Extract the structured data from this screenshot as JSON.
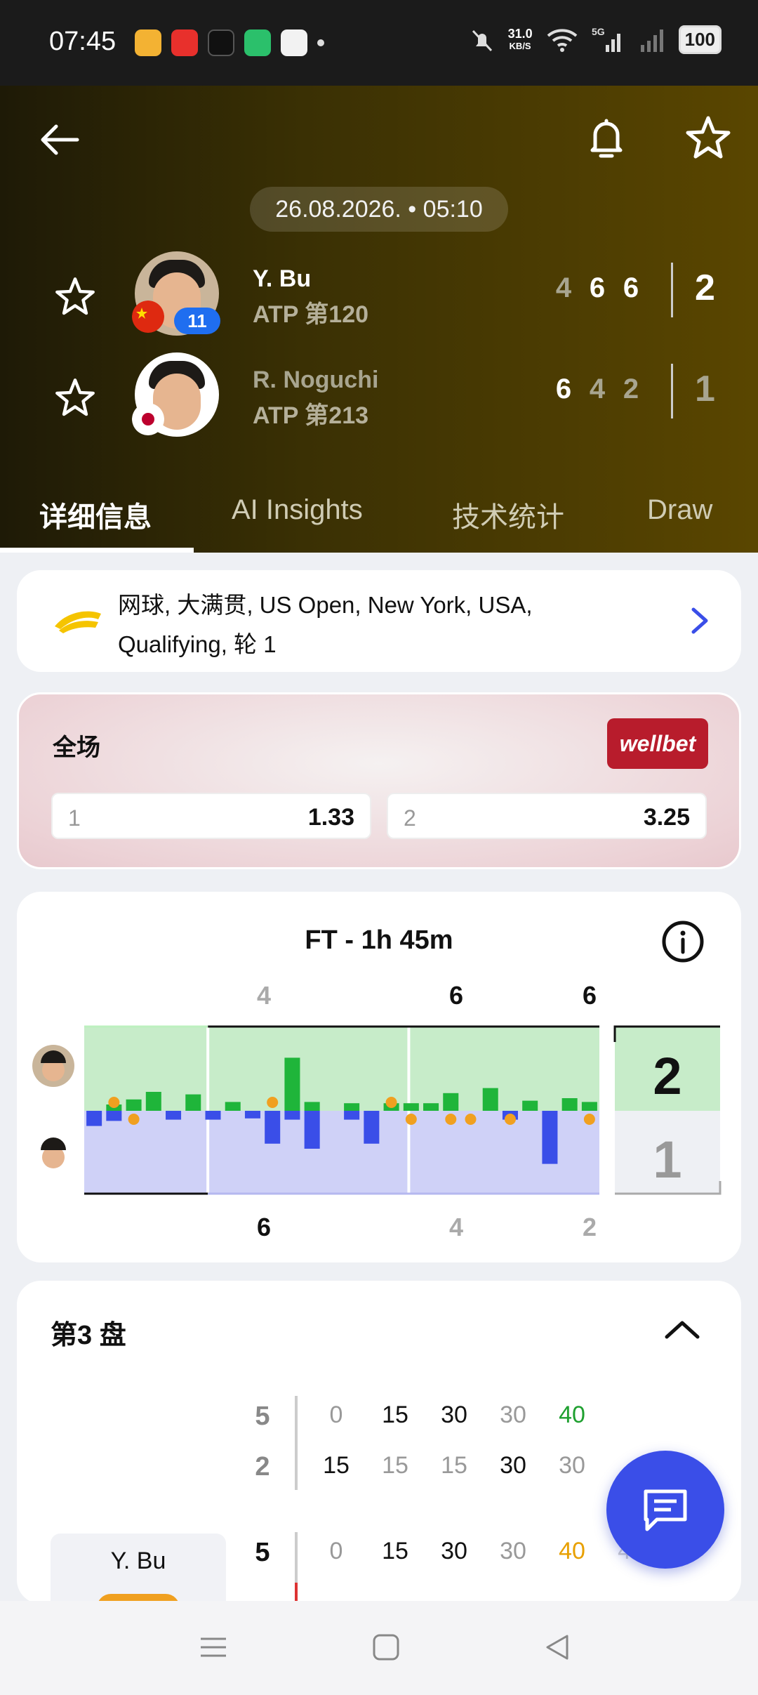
{
  "status_bar": {
    "time": "07:45",
    "speed_value": "31.0",
    "speed_unit": "KB/S",
    "network": "5G",
    "battery": "100"
  },
  "header": {
    "datetime": "26.08.2026. • 05:10",
    "players": [
      {
        "name": "Y. Bu",
        "rank": "ATP 第120",
        "seed": "11",
        "sets": [
          "4",
          "6",
          "6"
        ],
        "total": "2",
        "flag": "china"
      },
      {
        "name": "R. Noguchi",
        "rank": "ATP 第213",
        "sets": [
          "6",
          "4",
          "2"
        ],
        "total": "1",
        "flag": "japan"
      }
    ],
    "tabs": [
      "详细信息",
      "AI Insights",
      "技术统计",
      "Draw"
    ]
  },
  "competition": {
    "line1": "网球, 大满贯, US Open, New York, USA,",
    "line2": "Qualifying, 轮 1"
  },
  "odds": {
    "title": "全场",
    "brand": "wellbet",
    "options": [
      {
        "label": "1",
        "value": "1.33"
      },
      {
        "label": "2",
        "value": "3.25"
      }
    ]
  },
  "momentum": {
    "title": "FT - 1h 45m",
    "top_set_scores": [
      "4",
      "6",
      "6"
    ],
    "bottom_set_scores": [
      "6",
      "4",
      "2"
    ],
    "totals": [
      "2",
      "1"
    ],
    "colors": {
      "p1": "#1fb53a",
      "p2": "#3a4ee8",
      "p1_bg": "#c7ecc9",
      "p2_bg": "#cfd1f7"
    },
    "chart_data": {
      "type": "bar",
      "series": [
        {
          "name": "Y. Bu",
          "values": [
            0,
            0.5,
            0.9,
            1.5,
            0,
            1.3,
            0,
            0.7,
            0,
            0,
            4.2,
            0.7,
            0,
            0.6,
            0,
            0.6,
            0.6,
            0.6,
            1.4,
            0,
            1.8,
            0,
            0.8,
            0,
            1.0,
            0.7
          ]
        },
        {
          "name": "R. Noguchi",
          "values": [
            1.2,
            0.8,
            0,
            0,
            0.7,
            0,
            0.7,
            0,
            0.6,
            2.6,
            0.7,
            3.0,
            0,
            0.7,
            2.6,
            0,
            0,
            0,
            0,
            0,
            0,
            0.7,
            0,
            4.2,
            0,
            0
          ]
        }
      ]
    }
  },
  "set_detail": {
    "title": "第3 盘",
    "rows": [
      {
        "games": "5",
        "points": [
          "0",
          "15",
          "30",
          "30",
          "40"
        ]
      },
      {
        "games": "2",
        "points": [
          "15",
          "15",
          "15",
          "30",
          "30"
        ]
      },
      {
        "games": "5",
        "points": [
          "0",
          "15",
          "30",
          "30",
          "40",
          "40"
        ]
      }
    ],
    "player_label": "Y. Bu"
  }
}
